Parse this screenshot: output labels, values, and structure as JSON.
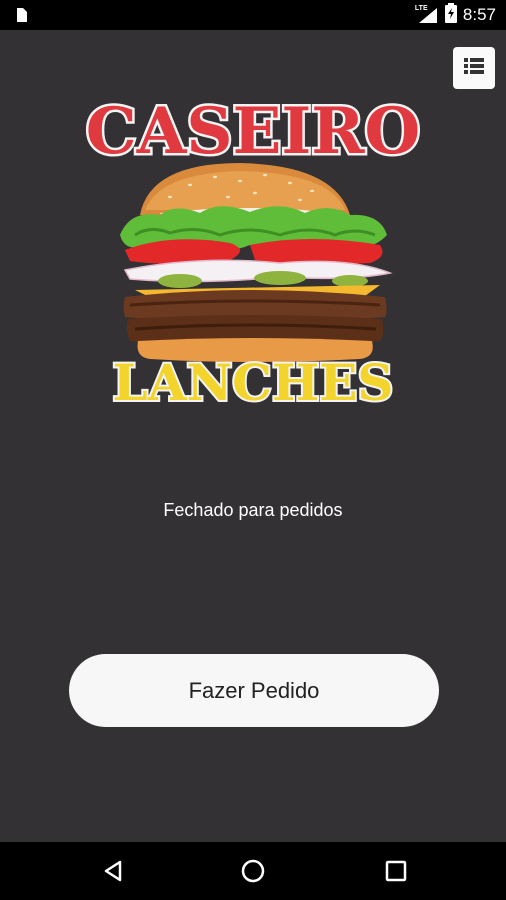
{
  "status_bar": {
    "time": "8:57",
    "network_label": "LTE",
    "icons": [
      "sim-card-icon",
      "signal-icon",
      "battery-charging-icon"
    ]
  },
  "header": {
    "menu_icon": "list-icon"
  },
  "logo": {
    "title_top": "CASEIRO",
    "title_bottom": "LANCHES",
    "image": "hamburger-icon",
    "colors": {
      "top": "#e0393f",
      "bottom": "#f2d42c"
    }
  },
  "main": {
    "status_text": "Fechado para pedidos",
    "order_button_label": "Fazer Pedido"
  },
  "nav_bar": {
    "icons": [
      "back-icon",
      "home-icon",
      "recents-icon"
    ]
  }
}
